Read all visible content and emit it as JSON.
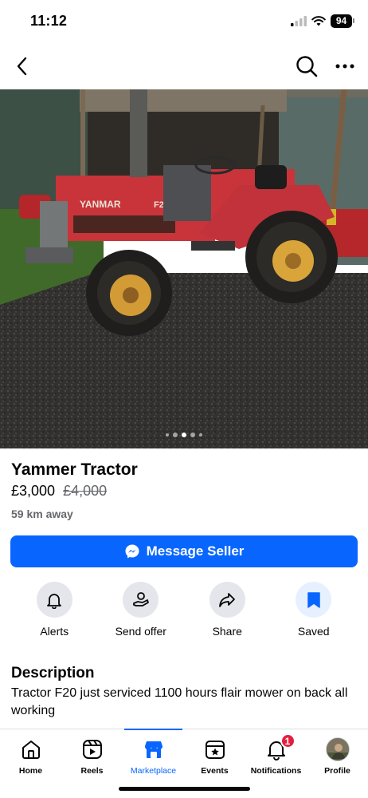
{
  "status_bar": {
    "time": "11:12",
    "battery": "94"
  },
  "listing": {
    "title": "Yammer Tractor",
    "price": "£3,000",
    "original_price": "£4,000",
    "distance": "59 km away",
    "photo_count": 5,
    "active_photo": 3
  },
  "message_button": {
    "label": "Message Seller"
  },
  "actions": [
    {
      "label": "Alerts",
      "icon": "bell-icon"
    },
    {
      "label": "Send offer",
      "icon": "offer-icon"
    },
    {
      "label": "Share",
      "icon": "share-icon"
    },
    {
      "label": "Saved",
      "icon": "bookmark-icon"
    }
  ],
  "description": {
    "heading": "Description",
    "text": "Tractor F20 just serviced 1100 hours flair mower on back all working"
  },
  "tabs": [
    {
      "label": "Home",
      "icon": "home-icon"
    },
    {
      "label": "Reels",
      "icon": "reels-icon"
    },
    {
      "label": "Marketplace",
      "icon": "marketplace-icon",
      "active": true
    },
    {
      "label": "Events",
      "icon": "events-icon"
    },
    {
      "label": "Notifications",
      "icon": "bell-icon",
      "badge": "1"
    },
    {
      "label": "Profile",
      "icon": "avatar"
    }
  ],
  "colors": {
    "accent": "#0866ff",
    "badge": "#e41e3f",
    "secondary_text": "#65676b"
  }
}
